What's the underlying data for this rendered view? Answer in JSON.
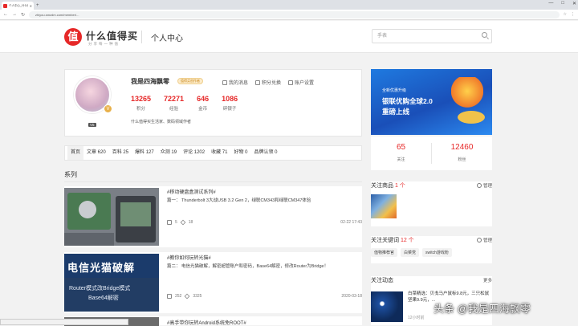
{
  "browser": {
    "tab_title": "个人中心_什么值得买",
    "new_tab": "+",
    "url": "zhiyou.smzdm.com/member/...",
    "window_controls": [
      "—",
      "□",
      "✕"
    ]
  },
  "header": {
    "logo_char": "值",
    "brand": "什么值得买",
    "slogan": "分享每一种值",
    "page_title": "个人中心",
    "search_placeholder": "手表"
  },
  "profile": {
    "name": "我是四海飘零",
    "badge": "值得买创作者",
    "level": "V5",
    "links": [
      "我的消息",
      "积分兑换",
      "账户设置"
    ],
    "stats": [
      {
        "value": "13265",
        "label": "积分"
      },
      {
        "value": "72271",
        "label": "经验"
      },
      {
        "value": "646",
        "label": "金币"
      },
      {
        "value": "1086",
        "label": "碎银子"
      }
    ],
    "bio": "什么值得买生活家、数码领域作者"
  },
  "tabs": [
    "首页",
    "文章 620",
    "百科 25",
    "爆料 127",
    "众测 19",
    "评论 1202",
    "收藏 71",
    "好物 0",
    "品牌认领 0"
  ],
  "section_title": "系列",
  "series": [
    {
      "title": "#移动硬盘盒测试系列#",
      "desc": "篇一： Thunderbolt 3大战USB 3.2 Gen 2，绿联CM343和绿联CM347体验",
      "likes": "5",
      "favs": "18",
      "date": "02-22 17:43"
    },
    {
      "title": "#教你如何玩转光猫#",
      "desc": "篇二： 电信光猫破解，解密超管账户和密码，Base64解密，修改Router为Bridge！",
      "thumb_text_1": "电信光猫破解",
      "thumb_text_2": "Router模式改Bridge模式",
      "thumb_text_3": "Base64解密",
      "likes": "252",
      "favs": "3325",
      "date": "2020-03-18"
    },
    {
      "title": "#高手带你玩转Android系统免ROOT#"
    }
  ],
  "banner": {
    "line1": "全新优惠升级",
    "line2": "银联优购全球2.0",
    "line3": "重磅上线"
  },
  "right_stats": [
    {
      "value": "65",
      "label": "关注"
    },
    {
      "value": "12460",
      "label": "粉丝"
    }
  ],
  "follow_goods": {
    "title": "关注商品",
    "count": "1 个",
    "action": "管理"
  },
  "follow_keywords": {
    "title": "关注关键词",
    "count": "12 个",
    "action": "管理",
    "chips": [
      "值物推荐官",
      "白菜党",
      "switch游戏粉"
    ]
  },
  "feed": {
    "title": "关注动态",
    "action": "更多",
    "text": "白菜精选：贝戋马户鼠标9.8元，三只松鼠坚果9.9元，...",
    "time": "12小时前"
  },
  "watermark": "头条 @我是四海飘零",
  "colors": {
    "accent": "#e62828",
    "banner": "#1f7ae0"
  }
}
